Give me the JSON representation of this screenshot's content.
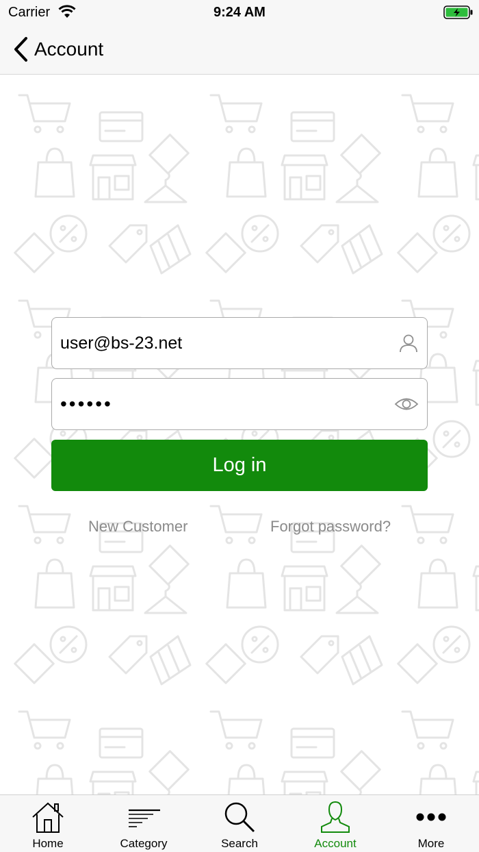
{
  "status_bar": {
    "carrier": "Carrier",
    "time": "9:24 AM"
  },
  "nav": {
    "back_label": "Account"
  },
  "login_form": {
    "email_value": "user@bs-23.net",
    "password_value": "••••••",
    "login_button": "Log in",
    "new_customer_link": "New Customer",
    "forgot_password_link": "Forgot password?"
  },
  "tab_bar": {
    "items": [
      {
        "label": "Home",
        "icon": "home-icon"
      },
      {
        "label": "Category",
        "icon": "category-icon"
      },
      {
        "label": "Search",
        "icon": "search-icon"
      },
      {
        "label": "Account",
        "icon": "account-icon",
        "active": true
      },
      {
        "label": "More",
        "icon": "more-icon"
      }
    ]
  },
  "colors": {
    "accent": "#128a0c",
    "link": "#8a8a8a",
    "bar_bg": "#f7f7f7",
    "battery": "#2dbd3c"
  }
}
